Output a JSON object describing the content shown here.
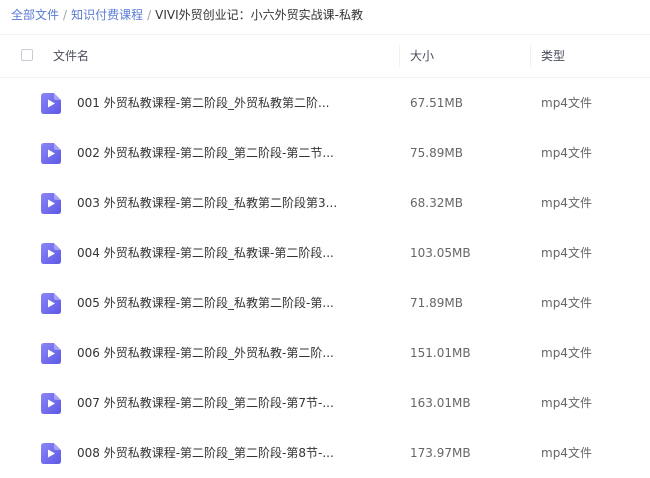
{
  "breadcrumb": {
    "items": [
      "全部文件",
      "知识付费课程",
      "VIVI外贸创业记：小六外贸实战课-私教"
    ],
    "separator": "/"
  },
  "table": {
    "headers": {
      "name": "文件名",
      "size": "大小",
      "type": "类型"
    },
    "rows": [
      {
        "name": "001 外贸私教课程-第二阶段_外贸私教第二阶...",
        "size": "67.51MB",
        "type": "mp4文件",
        "icon": "video-file-icon"
      },
      {
        "name": "002 外贸私教课程-第二阶段_第二阶段-第二节...",
        "size": "75.89MB",
        "type": "mp4文件",
        "icon": "video-file-icon"
      },
      {
        "name": "003 外贸私教课程-第二阶段_私教第二阶段第3...",
        "size": "68.32MB",
        "type": "mp4文件",
        "icon": "video-file-icon"
      },
      {
        "name": "004 外贸私教课程-第二阶段_私教课-第二阶段...",
        "size": "103.05MB",
        "type": "mp4文件",
        "icon": "video-file-icon"
      },
      {
        "name": "005 外贸私教课程-第二阶段_私教第二阶段-第...",
        "size": "71.89MB",
        "type": "mp4文件",
        "icon": "video-file-icon"
      },
      {
        "name": "006 外贸私教课程-第二阶段_外贸私教-第二阶...",
        "size": "151.01MB",
        "type": "mp4文件",
        "icon": "video-file-icon"
      },
      {
        "name": "007 外贸私教课程-第二阶段_第二阶段-第7节-...",
        "size": "163.01MB",
        "type": "mp4文件",
        "icon": "video-file-icon"
      },
      {
        "name": "008 外贸私教课程-第二阶段_第二阶段-第8节-...",
        "size": "173.97MB",
        "type": "mp4文件",
        "icon": "video-file-icon"
      }
    ]
  },
  "colors": {
    "link": "#5a7bd6",
    "icon_gradient_start": "#8a86f5",
    "icon_gradient_end": "#5d58e6"
  }
}
